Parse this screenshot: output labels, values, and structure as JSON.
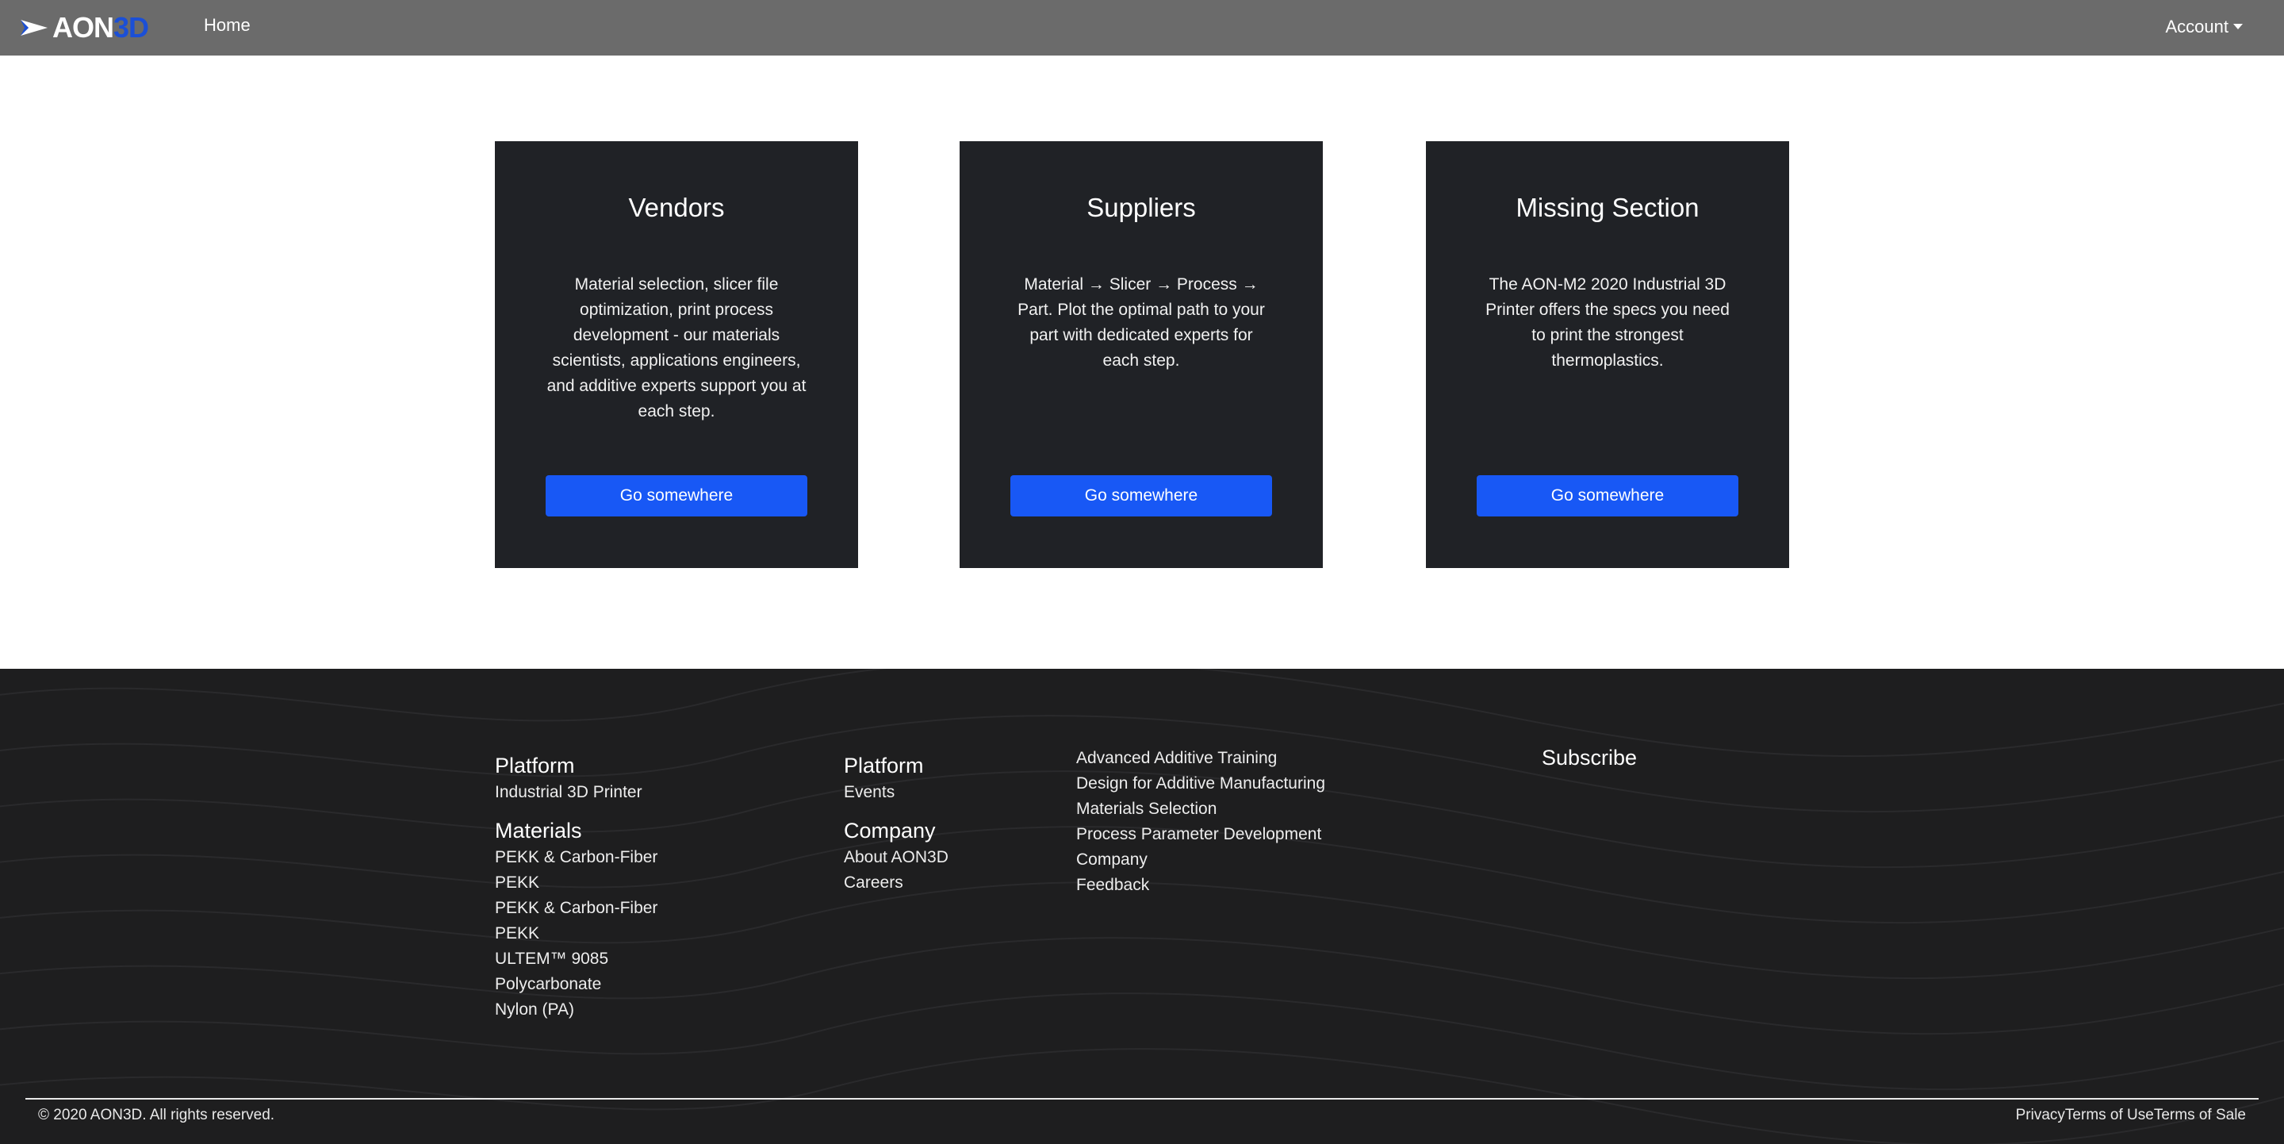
{
  "navbar": {
    "brand_aon": "AON",
    "brand_3d": "3D",
    "home_label": "Home",
    "account_label": "Account"
  },
  "cards": [
    {
      "title": "Vendors",
      "text": "Material selection, slicer file optimization, print process development - our materials scientists, applications engineers, and additive experts support you at each step.",
      "button": "Go somewhere"
    },
    {
      "title": "Suppliers",
      "text": "Material → Slicer → Process → Part. Plot the optimal path to your part with dedicated experts for each step.",
      "button": "Go somewhere"
    },
    {
      "title": "Missing Section",
      "text": "The AON-M2 2020 Industrial 3D Printer offers the specs you need to print the strongest thermoplastics.",
      "button": "Go somewhere"
    }
  ],
  "footer": {
    "col1": {
      "heading1": "Platform",
      "items1": [
        "Industrial 3D Printer"
      ],
      "heading2": "Materials",
      "items2": [
        "PEKK & Carbon-Fiber",
        "PEKK",
        "PEKK & Carbon-Fiber",
        "PEKK",
        "ULTEM™ 9085",
        "Polycarbonate",
        "Nylon (PA)"
      ]
    },
    "col2": {
      "heading1": "Platform",
      "items1": [
        "Events"
      ],
      "heading2": "Company",
      "items2": [
        "About AON3D",
        "Careers"
      ]
    },
    "col3": {
      "items": [
        "Advanced Additive Training",
        "Design for Additive Manufacturing",
        "Materials Selection",
        "Process Parameter Development",
        "Company",
        "Feedback"
      ]
    },
    "subscribe_heading": "Subscribe",
    "copyright": "© 2020 AON3D. All rights reserved.",
    "legal": {
      "privacy": "Privacy",
      "terms_of_use": "Terms of Use",
      "terms_of_sale": "Terms of Sale"
    }
  },
  "colors": {
    "navbar": "#6b6b6b",
    "brand_accent": "#1b4fd6",
    "card_bg": "#202226",
    "button": "#1858f5",
    "footer_bg": "#1e1e1f"
  }
}
